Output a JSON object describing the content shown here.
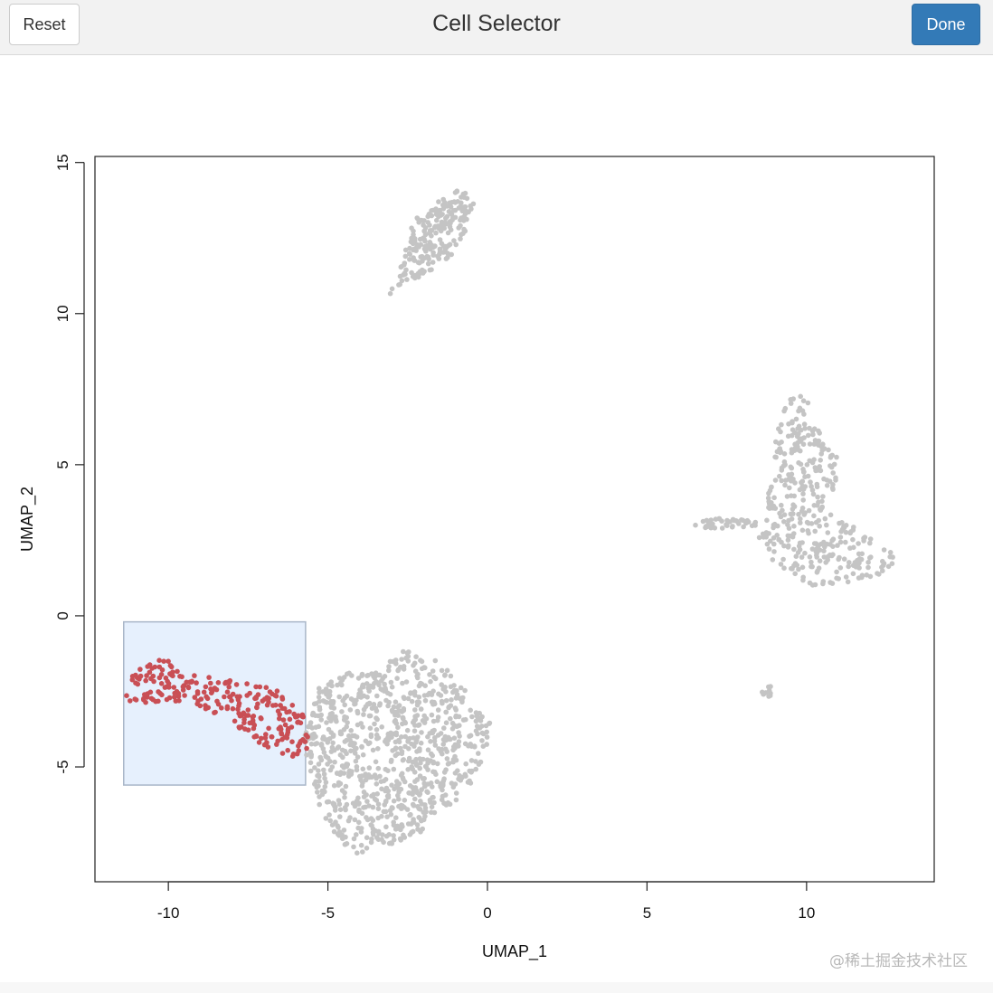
{
  "header": {
    "title": "Cell Selector",
    "reset_label": "Reset",
    "done_label": "Done"
  },
  "watermark": "@稀土掘金技术社区",
  "colors": {
    "unselected": "#c4c4c4",
    "selected": "#c94f55",
    "brush_fill": "#e6f0fd",
    "brush_stroke": "#a9b6c8",
    "done_button": "#337ab7"
  },
  "chart_data": {
    "type": "scatter",
    "xlabel": "UMAP_1",
    "ylabel": "UMAP_2",
    "xlim": [
      -12.3,
      14.0
    ],
    "ylim": [
      -8.8,
      15.2
    ],
    "x_ticks": [
      -10,
      -5,
      0,
      5,
      10
    ],
    "x_tick_labels": [
      "-10",
      "-5",
      "0",
      "5",
      "10"
    ],
    "y_ticks": [
      -5,
      0,
      5,
      10,
      15
    ],
    "y_tick_labels": [
      "-5",
      "0",
      "5",
      "10",
      "15"
    ],
    "grid": false,
    "selection_rectangle": {
      "x": [
        -11.4,
        -5.7
      ],
      "y": [
        -5.6,
        -0.2
      ]
    },
    "clusters": [
      {
        "id": "top",
        "selected": false,
        "n": 220,
        "polygon": [
          [
            -3.1,
            10.6
          ],
          [
            -2.8,
            11.2
          ],
          [
            -2.6,
            12.2
          ],
          [
            -2.3,
            13.1
          ],
          [
            -1.6,
            13.7
          ],
          [
            -0.8,
            14.2
          ],
          [
            -0.4,
            13.6
          ],
          [
            -0.7,
            12.6
          ],
          [
            -1.2,
            11.8
          ],
          [
            -2.0,
            11.3
          ],
          [
            -2.7,
            10.8
          ]
        ]
      },
      {
        "id": "bottom-center",
        "selected": false,
        "n": 900,
        "polygon": [
          [
            -5.6,
            -3.4
          ],
          [
            -5.3,
            -2.4
          ],
          [
            -4.5,
            -1.9
          ],
          [
            -3.4,
            -1.8
          ],
          [
            -2.6,
            -1.1
          ],
          [
            -1.8,
            -1.3
          ],
          [
            -0.9,
            -2.1
          ],
          [
            -0.3,
            -3.0
          ],
          [
            0.2,
            -3.6
          ],
          [
            -0.1,
            -4.5
          ],
          [
            -0.5,
            -5.7
          ],
          [
            -1.6,
            -6.6
          ],
          [
            -2.1,
            -7.3
          ],
          [
            -3.0,
            -7.6
          ],
          [
            -4.2,
            -7.9
          ],
          [
            -5.0,
            -7.0
          ],
          [
            -5.5,
            -5.6
          ],
          [
            -5.8,
            -4.3
          ]
        ]
      },
      {
        "id": "left-selected",
        "selected": true,
        "n": 250,
        "polygon": [
          [
            -11.4,
            -2.2
          ],
          [
            -10.8,
            -1.6
          ],
          [
            -10.2,
            -1.3
          ],
          [
            -9.6,
            -1.7
          ],
          [
            -8.8,
            -2.0
          ],
          [
            -7.8,
            -2.2
          ],
          [
            -6.8,
            -2.3
          ],
          [
            -6.0,
            -3.0
          ],
          [
            -5.6,
            -3.5
          ],
          [
            -5.6,
            -4.4
          ],
          [
            -6.2,
            -4.7
          ],
          [
            -7.2,
            -4.2
          ],
          [
            -8.2,
            -3.4
          ],
          [
            -9.4,
            -2.8
          ],
          [
            -10.6,
            -2.9
          ],
          [
            -11.3,
            -2.8
          ]
        ]
      },
      {
        "id": "right",
        "selected": false,
        "n": 380,
        "polygon": [
          [
            9.2,
            6.6
          ],
          [
            9.6,
            7.4
          ],
          [
            10.0,
            7.3
          ],
          [
            10.2,
            6.6
          ],
          [
            10.6,
            5.6
          ],
          [
            11.0,
            5.2
          ],
          [
            10.9,
            4.4
          ],
          [
            10.8,
            3.6
          ],
          [
            11.4,
            3.0
          ],
          [
            12.2,
            2.4
          ],
          [
            12.8,
            2.1
          ],
          [
            13.1,
            1.9
          ],
          [
            12.6,
            1.5
          ],
          [
            11.8,
            1.2
          ],
          [
            11.0,
            1.0
          ],
          [
            10.2,
            0.9
          ],
          [
            9.6,
            1.4
          ],
          [
            8.9,
            1.8
          ],
          [
            8.5,
            2.6
          ],
          [
            8.7,
            3.5
          ],
          [
            8.9,
            4.6
          ],
          [
            9.0,
            5.7
          ]
        ]
      },
      {
        "id": "right-tail",
        "selected": false,
        "n": 40,
        "polygon": [
          [
            6.5,
            3.0
          ],
          [
            7.1,
            3.3
          ],
          [
            7.8,
            3.2
          ],
          [
            8.5,
            3.1
          ],
          [
            8.4,
            2.9
          ],
          [
            7.6,
            2.9
          ],
          [
            6.9,
            2.9
          ]
        ]
      },
      {
        "id": "small",
        "selected": false,
        "n": 10,
        "polygon": [
          [
            8.6,
            -2.3
          ],
          [
            8.9,
            -2.3
          ],
          [
            8.9,
            -2.7
          ],
          [
            8.6,
            -2.7
          ]
        ]
      }
    ]
  }
}
